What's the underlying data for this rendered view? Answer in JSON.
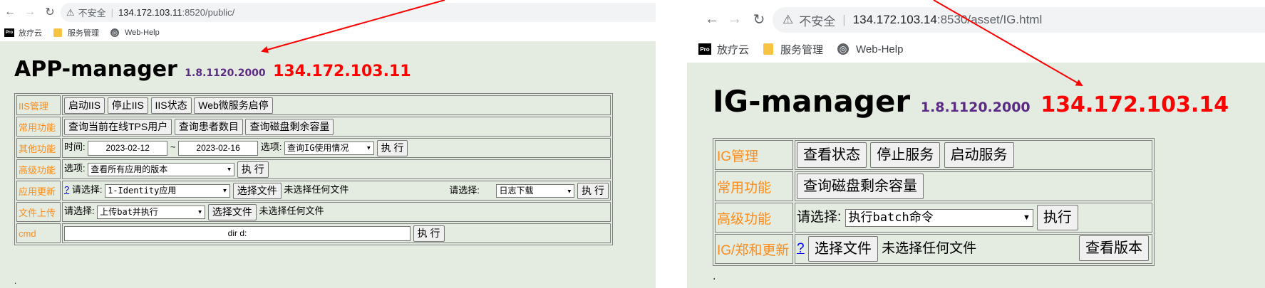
{
  "left": {
    "url_prefix": "134.172.103.11",
    "url_suffix": ":8520/public/",
    "security_text": "不安全",
    "bookmarks": [
      "放疗云",
      "服务管理",
      "Web-Help"
    ],
    "pro_icon_text": "Pro",
    "title": "APP-manager",
    "version": "1.8.1120.2000",
    "ip": "134.172.103.11",
    "rows": {
      "iis_label": "IIS管理",
      "iis_buttons": [
        "启动IIS",
        "停止IIS",
        "IIS状态",
        "Web微服务启停"
      ],
      "common_label": "常用功能",
      "common_buttons": [
        "查询当前在线TPS用户",
        "查询患者数目",
        "查询磁盘剩余容量"
      ],
      "other_label": "其他功能",
      "time_label": "时间:",
      "date_from": "2023-02-12",
      "tilde": "~",
      "date_to": "2023-02-16",
      "option_label": "选项:",
      "other_select": "查询IG使用情况",
      "run": "执 行",
      "advanced_label": "高级功能",
      "advanced_option_label": "选项:",
      "advanced_select": "查看所有应用的版本",
      "update_label": "应用更新",
      "update_help": "?",
      "please_select": "请选择:",
      "update_select": "1-Identity应用",
      "choose_file": "选择文件",
      "no_file": "未选择任何文件",
      "please_select2": "请选择:",
      "log_select": "日志下载",
      "upload_label": "文件上传",
      "upload_please_select": "请选择:",
      "upload_select": "上传bat并执行",
      "cmd_label": "cmd",
      "cmd_value": "dir d:"
    },
    "dot": "."
  },
  "right": {
    "url_prefix": "134.172.103.14",
    "url_suffix": ":8530/asset/IG.html",
    "security_text": "不安全",
    "bookmarks": [
      "放疗云",
      "服务管理",
      "Web-Help"
    ],
    "pro_icon_text": "Pro",
    "title": "IG-manager",
    "version": "1.8.1120.2000",
    "ip": "134.172.103.14",
    "rows": {
      "ig_label": "IG管理",
      "ig_buttons": [
        "查看状态",
        "停止服务",
        "启动服务"
      ],
      "common_label": "常用功能",
      "common_buttons": [
        "查询磁盘剩余容量"
      ],
      "advanced_label": "高级功能",
      "please_select": "请选择:",
      "advanced_select": "执行batch命令",
      "run": "执行",
      "update_label": "IG/郑和更新",
      "update_help": "?",
      "choose_file": "选择文件",
      "no_file": "未选择任何文件",
      "view_version": "查看版本"
    },
    "dot": "."
  },
  "colors": {
    "page_bg": "#e4ebe0",
    "label_orange": "#ff8c1a",
    "ip_red": "#ff0000",
    "version_purple": "#5b2a86",
    "arrow_red": "#ff0000"
  },
  "icons": [
    "back-arrow-icon",
    "forward-arrow-icon",
    "reload-icon",
    "warning-icon",
    "pro-icon",
    "folder-icon",
    "globe-icon",
    "dropdown-arrow-icon"
  ]
}
